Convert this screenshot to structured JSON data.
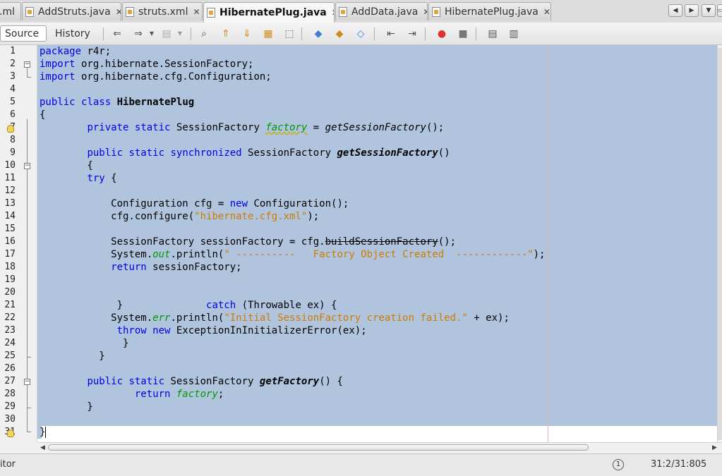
{
  "tabs": [
    {
      "label": ".ml",
      "close": "",
      "active": false
    },
    {
      "label": "AddStruts.java",
      "close": "✕",
      "active": false
    },
    {
      "label": "struts.xml",
      "close": "✕",
      "active": false
    },
    {
      "label": "HibernatePlug.java",
      "close": "✕",
      "active": true
    },
    {
      "label": "AddData.java",
      "close": "✕",
      "active": false
    },
    {
      "label": "HibernatePlug.java",
      "close": "✕",
      "active": false
    }
  ],
  "tab_nav": {
    "prev": "◀",
    "next": "▶",
    "list": "▼",
    "restore": "▭"
  },
  "toolbar": {
    "source_label": "Source",
    "history_label": "History",
    "icons": [
      "back-icon",
      "forward-icon",
      "dropdown-icon",
      "disabled-icon",
      "dropdown-icon",
      "find-icon",
      "find-previous-icon",
      "find-next-icon",
      "highlight-icon",
      "select-icon",
      "previous-bookmark-icon",
      "next-bookmark-icon",
      "toggle-bookmark-icon",
      "shift-left-icon",
      "shift-right-icon",
      "record-macro-icon",
      "stop-macro-icon",
      "comment-icon",
      "uncomment-icon"
    ]
  },
  "editor": {
    "line_numbers": [
      "1",
      "2",
      "3",
      "4",
      "5",
      "6",
      "7",
      "8",
      "9",
      "10",
      "11",
      "12",
      "13",
      "14",
      "15",
      "16",
      "17",
      "18",
      "19",
      "20",
      "21",
      "22",
      "23",
      "24",
      "25",
      "26",
      "27",
      "28",
      "29",
      "30",
      "31"
    ],
    "lines": [
      [
        [
          "kw",
          "package"
        ],
        [
          "t",
          " r4r;"
        ]
      ],
      [
        [
          "kw",
          "import"
        ],
        [
          "t",
          " org.hibernate.SessionFactory;"
        ]
      ],
      [
        [
          "kw",
          "import"
        ],
        [
          "t",
          " org.hibernate.cfg.Configuration;"
        ]
      ],
      [],
      [
        [
          "kw",
          "public"
        ],
        [
          "t",
          " "
        ],
        [
          "kw",
          "class"
        ],
        [
          "t",
          " "
        ],
        [
          "cls",
          "HibernatePlug"
        ]
      ],
      [
        [
          "t",
          "{"
        ]
      ],
      [
        [
          "t",
          "        "
        ],
        [
          "kw",
          "private"
        ],
        [
          "t",
          " "
        ],
        [
          "kw",
          "static"
        ],
        [
          "t",
          " SessionFactory "
        ],
        [
          "fld warnfld",
          "factory"
        ],
        [
          "t",
          " = "
        ],
        [
          "stat",
          "getSessionFactory"
        ],
        [
          "t",
          "();"
        ]
      ],
      [],
      [
        [
          "t",
          "        "
        ],
        [
          "kw",
          "public"
        ],
        [
          "t",
          " "
        ],
        [
          "kw",
          "static"
        ],
        [
          "t",
          " "
        ],
        [
          "kw",
          "synchronized"
        ],
        [
          "t",
          " SessionFactory "
        ],
        [
          "mdecl",
          "getSessionFactory"
        ],
        [
          "t",
          "()"
        ]
      ],
      [
        [
          "t",
          "        {"
        ]
      ],
      [
        [
          "t",
          "        "
        ],
        [
          "kw",
          "try"
        ],
        [
          "t",
          " {"
        ]
      ],
      [],
      [
        [
          "t",
          "            Configuration cfg = "
        ],
        [
          "kw",
          "new"
        ],
        [
          "t",
          " Configuration();"
        ]
      ],
      [
        [
          "t",
          "            cfg.configure("
        ],
        [
          "str",
          "\"hibernate.cfg.xml\""
        ],
        [
          "t",
          ");"
        ]
      ],
      [],
      [
        [
          "t",
          "            SessionFactory sessionFactory = cfg."
        ],
        [
          "depr",
          "buildSessionFactory"
        ],
        [
          "t",
          "();"
        ]
      ],
      [
        [
          "t",
          "            System."
        ],
        [
          "fld",
          "out"
        ],
        [
          "t",
          ".println("
        ],
        [
          "str",
          "\" ----------   Factory Object Created  ------------\""
        ],
        [
          "t",
          ");"
        ]
      ],
      [
        [
          "t",
          "            "
        ],
        [
          "kw",
          "return"
        ],
        [
          "t",
          " sessionFactory;"
        ]
      ],
      [],
      [],
      [
        [
          "t",
          "             }              "
        ],
        [
          "kw",
          "catch"
        ],
        [
          "t",
          " (Throwable ex) {"
        ]
      ],
      [
        [
          "t",
          "            System."
        ],
        [
          "fld",
          "err"
        ],
        [
          "t",
          ".println("
        ],
        [
          "str",
          "\"Initial SessionFactory creation failed.\""
        ],
        [
          "t",
          " + ex);"
        ]
      ],
      [
        [
          "t",
          "             "
        ],
        [
          "kw",
          "throw"
        ],
        [
          "t",
          " "
        ],
        [
          "kw",
          "new"
        ],
        [
          "t",
          " ExceptionInInitializerError(ex);"
        ]
      ],
      [
        [
          "t",
          "              }"
        ]
      ],
      [
        [
          "t",
          "          }"
        ]
      ],
      [],
      [
        [
          "t",
          "        "
        ],
        [
          "kw",
          "public"
        ],
        [
          "t",
          " "
        ],
        [
          "kw",
          "static"
        ],
        [
          "t",
          " SessionFactory "
        ],
        [
          "mdecl",
          "getFactory"
        ],
        [
          "t",
          "() {"
        ]
      ],
      [
        [
          "t",
          "                "
        ],
        [
          "kw",
          "return"
        ],
        [
          "t",
          " "
        ],
        [
          "fld",
          "factory"
        ],
        [
          "t",
          ";"
        ]
      ],
      [
        [
          "t",
          "        }"
        ]
      ],
      [],
      [
        [
          "t",
          "}"
        ]
      ]
    ]
  },
  "status": {
    "left_text": "itor",
    "notification_icon": "1",
    "position": "31:2/31:805"
  },
  "colors": {
    "selection": "#b0c4de",
    "keyword": "#0000e6",
    "string": "#ce7b00",
    "field": "#009900"
  }
}
